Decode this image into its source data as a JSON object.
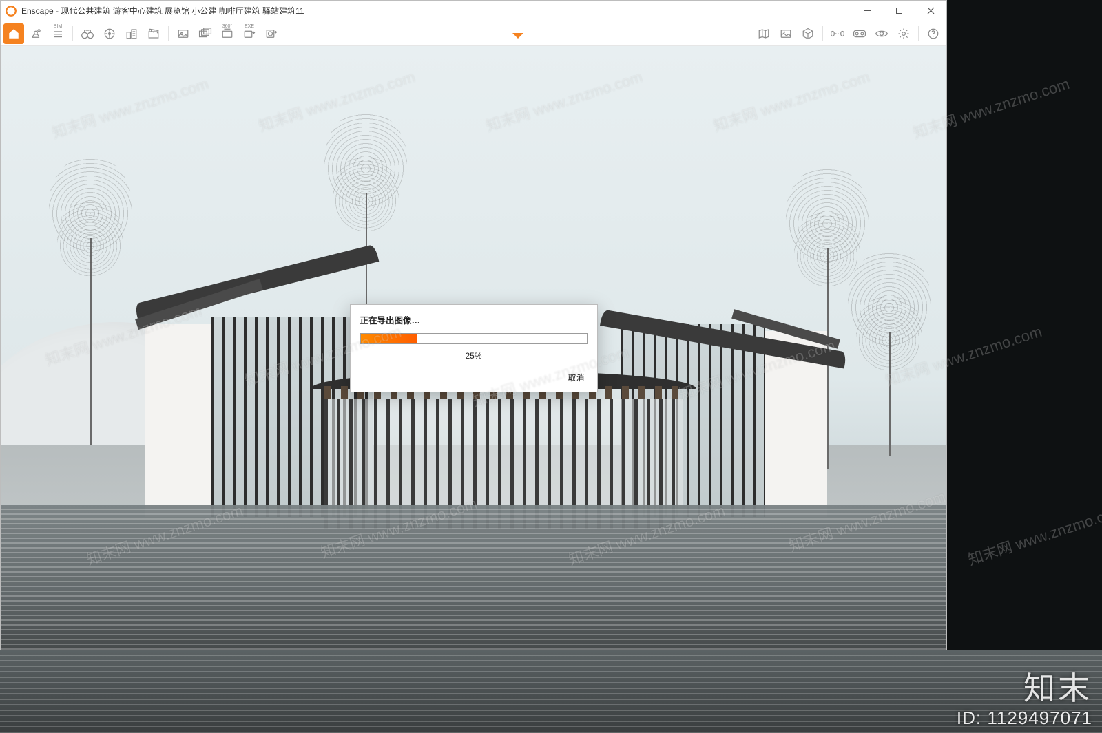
{
  "app": {
    "name": "Enscape",
    "title": "Enscape - 现代公共建筑 游客中心建筑 展览馆 小公建 咖啡厅建筑 驿站建筑11"
  },
  "window_controls": {
    "minimize": "–",
    "maximize": "□",
    "close": "✕"
  },
  "toolbar": {
    "left": [
      {
        "name": "home-icon",
        "active": true
      },
      {
        "name": "link-icon"
      },
      {
        "name": "bim-menu-icon",
        "label": "BIM"
      },
      {
        "name": "binoculars-icon"
      },
      {
        "name": "compass-icon"
      },
      {
        "name": "buildings-icon"
      },
      {
        "name": "clapperboard-icon"
      }
    ],
    "mid": [
      {
        "name": "screenshot-icon"
      },
      {
        "name": "batch-render-icon"
      },
      {
        "name": "pano-360-icon",
        "label": "360°"
      },
      {
        "name": "exe-export-icon",
        "label": "EXE"
      },
      {
        "name": "web-export-icon"
      }
    ],
    "right": [
      {
        "name": "map-icon"
      },
      {
        "name": "gallery-icon"
      },
      {
        "name": "cube-icon"
      },
      {
        "name": "compare-icon"
      },
      {
        "name": "vr-headset-icon"
      },
      {
        "name": "eye-icon"
      },
      {
        "name": "settings-gear-icon"
      },
      {
        "name": "help-icon"
      }
    ]
  },
  "dialog": {
    "title": "正在导出图像…",
    "progress_percent": 25,
    "progress_label": "25%",
    "cancel": "取消"
  },
  "watermark": {
    "text": "知末网 www.znzmo.com",
    "brand": "知末",
    "id_label": "ID: 1129497071"
  }
}
